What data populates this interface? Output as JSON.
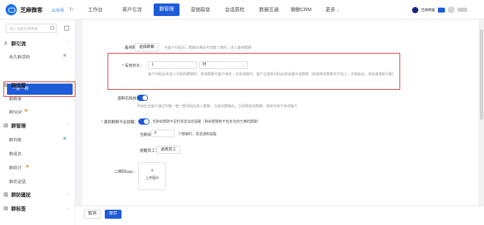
{
  "app": {
    "brand": "芝麻微客",
    "account": "公众号",
    "account_caret": "⌄"
  },
  "nav": [
    {
      "label": "工作台"
    },
    {
      "label": "客户引流"
    },
    {
      "label": "群管理",
      "active": true
    },
    {
      "label": "营销裂变"
    },
    {
      "label": "会话质检"
    },
    {
      "label": "数据互通"
    },
    {
      "label": "微鲸CRM"
    },
    {
      "label": "更多"
    }
  ],
  "user": {
    "name": "芝麻微客"
  },
  "sidebar": {
    "search_placeholder": "输入功能名称搜索",
    "groups": [
      {
        "label": "群引流",
        "items": [
          "永久群活码",
          "一客一群"
        ]
      },
      {
        "label": "群运营",
        "items": [
          "群群发",
          "群SOP"
        ]
      },
      {
        "label": "群管理",
        "items": [
          "群列表",
          "群成员",
          "群统计",
          "群欢迎语"
        ]
      },
      {
        "label": "群防骚扰"
      },
      {
        "label": "群标签"
      }
    ]
  },
  "form": {
    "backup_label": "备用群聊：",
    "backup_button": "选择群聊",
    "backup_hint": "当客户扫码后，群聊均满足可加群人数时，进入备用群聊",
    "time_label": "* 有效时长：",
    "time_value": "1",
    "time_unit": "时",
    "time_hint": "客户扫码后未进入分配的群聊时，将该群聊与客户绑定，在有效期内，客户在重新扫码后将会展示该群聊（如该绑定群聊无可加入，无需给出，将会被重新分配）",
    "auto_close_label": "退群后释放：",
    "auto_close_hint": "开启后当客户通过扫描一客一群活码后进入群聊，当退出群聊后，立即释放该群聊，使其可用于其他客户",
    "reminder_label": "* 满员群聊不足提醒：",
    "reminder_hint": "当剩余群聊不足时发送消息提醒（剩余群聊数不包含当前已满的群聊）",
    "remain_label": "当剩余",
    "remain_value": "0",
    "remain_suffix": "个群聊时，发送通知提醒",
    "staff_label": "提醒员工：",
    "staff_button": "选择员工",
    "logo_label": "二维码logo：",
    "upload_plus": "+",
    "upload_label": "上传图片"
  },
  "footer": {
    "cancel": "取消",
    "save": "保存"
  },
  "colors": {
    "accent": "#1e5bd8",
    "highlight": "#e53935"
  }
}
